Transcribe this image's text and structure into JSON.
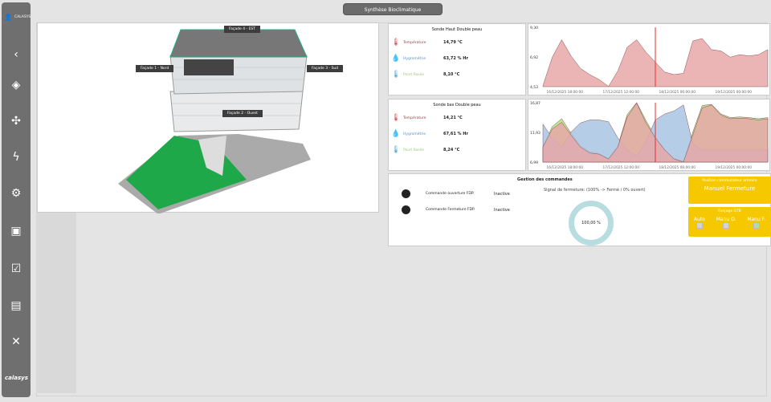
{
  "title": "Synthèse Bioclimatique",
  "sidebar": {
    "user": "CALASYS",
    "brand": "calasys",
    "icons": [
      "back-icon",
      "layers-icon",
      "fan-icon",
      "lightning-icon",
      "alarm-icon",
      "meter-icon",
      "checklist-icon",
      "chart-icon",
      "tools-icon"
    ],
    "color": "#6f6f6f"
  },
  "building": {
    "facades": [
      "Façade 4 - EST",
      "Façade 1 - Nord",
      "Façade 3 - Sud",
      "Façade 2 - Ouest"
    ]
  },
  "sondes": [
    {
      "title": "Sonde Haut Double peau",
      "rows": [
        {
          "label": "Température",
          "value": "14,79 °C",
          "color": "#a04040"
        },
        {
          "label": "Hygrométrie",
          "value": "63,72 % Hr",
          "color": "#5b8fc9"
        },
        {
          "label": "Point Rosée",
          "value": "8,10 °C",
          "color": "#9ccc7c"
        }
      ]
    },
    {
      "title": "Sonde bas Double peau",
      "rows": [
        {
          "label": "Température",
          "value": "14,21 °C",
          "color": "#a04040"
        },
        {
          "label": "Hygrométrie",
          "value": "67,61 % Hr",
          "color": "#5b8fc9"
        },
        {
          "label": "Point Rosée",
          "value": "8,24 °C",
          "color": "#9ccc7c"
        }
      ]
    }
  ],
  "chart_data": [
    {
      "type": "area",
      "ylim": [
        4.53,
        9.3
      ],
      "yticks": [
        "9,30",
        "6,92",
        "4,53"
      ],
      "xlim": [
        "16/12/2025 11:00",
        "19/12/2025 11:00"
      ],
      "step_hours": 3,
      "xticks": [
        "16/12/2025 18:00:00",
        "17/12/2025 12:00:00",
        "18/12/2025 06:00:00",
        "19/12/2025 00:00:00"
      ],
      "cursor": "17/12/2025 23:00",
      "series": [
        {
          "color": "#e8a8a8",
          "values": [
            4.6,
            6.9,
            8.3,
            7.0,
            6.0,
            5.5,
            5.1,
            4.55,
            5.8,
            7.7,
            8.3,
            7.3,
            6.5,
            5.7,
            5.5,
            5.6,
            8.2,
            8.4,
            7.5,
            7.4,
            6.9,
            7.1,
            7.0,
            7.1,
            7.5
          ]
        }
      ]
    },
    {
      "type": "area",
      "ylim": [
        6.99,
        16.87
      ],
      "yticks": [
        "16,87",
        "11,93",
        "6,99"
      ],
      "xlim": [
        "16/12/2025 11:00",
        "19/12/2025 11:00"
      ],
      "step_hours": 3,
      "xticks": [
        "16/12/2025 18:00:00",
        "17/12/2025 12:00:00",
        "18/12/2025 06:00:00",
        "19/12/2025 00:00:00"
      ],
      "cursor": "17/12/2025 23:00",
      "series": [
        {
          "color": "#b0e08a",
          "values": [
            9.6,
            12.9,
            14.2,
            11.8,
            9.7,
            8.7,
            8.4,
            7.6,
            9.7,
            14.9,
            16.9,
            13.9,
            11.2,
            9.1,
            7.6,
            7.1,
            12.0,
            16.4,
            16.6,
            15.0,
            14.4,
            14.5,
            14.4,
            14.2,
            14.4
          ]
        },
        {
          "color": "#a9c4e4",
          "values": [
            13.3,
            11.0,
            9.5,
            12.0,
            13.5,
            14.0,
            14.0,
            13.7,
            11.0,
            9.0,
            8.0,
            10.5,
            14.0,
            15.0,
            15.5,
            16.5,
            10.0,
            9.0,
            9.0,
            9.0,
            9.0,
            9.0,
            9.0,
            9.0,
            9.0
          ]
        },
        {
          "color": "#e8a8a8",
          "values": [
            9.5,
            12.5,
            13.6,
            11.5,
            9.5,
            8.5,
            8.3,
            7.5,
            9.5,
            14.5,
            16.8,
            13.5,
            11.0,
            9.0,
            7.5,
            7.0,
            11.5,
            16.0,
            16.5,
            14.8,
            14.2,
            14.3,
            14.2,
            14.0,
            14.2
          ]
        }
      ]
    }
  ],
  "commands": {
    "title": "Gestion des commandes",
    "items": [
      {
        "label": "Commande ouverture FDP.",
        "state": "Inactive"
      },
      {
        "label": "Commande Fermeture FDP.",
        "state": "Inactive"
      }
    ],
    "signal_label": "Signal de fermeture: (100% -> Fermé / 0% ouvert)",
    "signal_value": "100,00 %",
    "signal_fraction": 1.0,
    "position": {
      "title": "Position commutateur armoire",
      "value": "Manuel Fermeture"
    },
    "forcage": {
      "title": "Forçage GTB",
      "options": [
        {
          "label": "Auto",
          "checked": false
        },
        {
          "label": "Manu O.",
          "checked": false
        },
        {
          "label": "Manu F.",
          "checked": true
        }
      ]
    },
    "accent": "#f5c800"
  }
}
